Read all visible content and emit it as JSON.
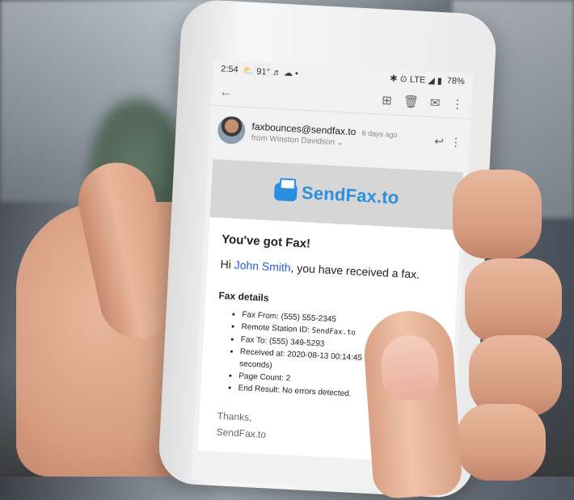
{
  "status_bar": {
    "time": "2:54",
    "left_icons": "⛅ 91° ♬ ☁ •",
    "right_icons": "✱ ⊙ LTE ◢ ▮",
    "battery": "78%"
  },
  "toolbar": {
    "back_icon": "arrow-left-icon",
    "archive_icon": "archive-icon",
    "delete_icon": "trash-icon",
    "mark_unread_icon": "mail-icon",
    "more_icon": "more-vert-icon"
  },
  "email": {
    "sender": "faxbounces@sendfax.to",
    "time": "6 days ago",
    "from": "from Winston Davidson",
    "reply_icon": "reply-all-icon"
  },
  "banner": {
    "logo_text": "SendFax.to",
    "brand_color": "#2b8fe0"
  },
  "message": {
    "heading": "You've got Fax!",
    "greeting_prefix": "Hi ",
    "recipient": "John Smith",
    "greeting_suffix": ", you have received a fax.",
    "details_title": "Fax details",
    "details": [
      {
        "label": "Fax From: (555) 555-2345"
      },
      {
        "label": "Remote Station ID: ",
        "mono": "SendFax.to"
      },
      {
        "label": "Fax To: (555) 349-5293"
      },
      {
        "label": "Received at: 2020-08-13 00:14:45"
      },
      {
        "label": "seconds)"
      },
      {
        "label": "Page Count: 2"
      },
      {
        "label": "End Result: No errors detected."
      }
    ],
    "signoff_1": "Thanks,",
    "signoff_2": "SendFax.to"
  }
}
